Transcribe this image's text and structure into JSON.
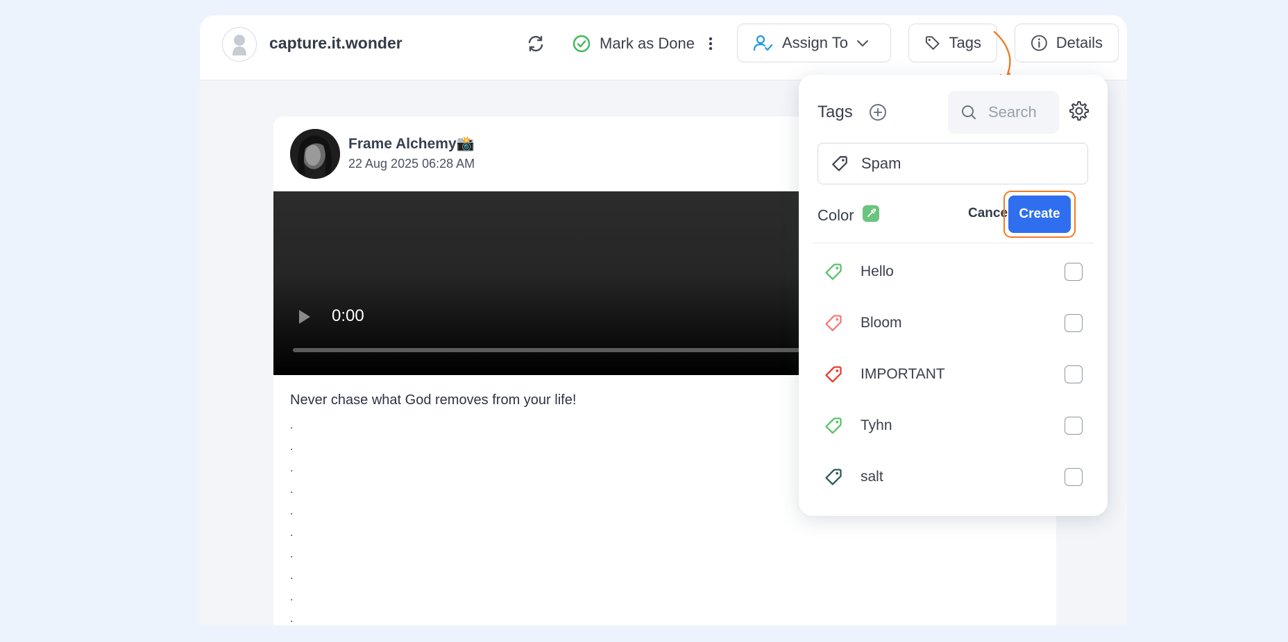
{
  "header": {
    "account_name": "capture.it.wonder",
    "mark_done_label": "Mark as Done",
    "assign_label": "Assign To",
    "tags_label": "Tags",
    "details_label": "Details"
  },
  "post": {
    "author": "Frame Alchemy📸",
    "date": "22 Aug 2025 06:28 AM",
    "video_time": "0:00",
    "caption": "Never chase what God removes from your life!",
    "dots": [
      ".",
      ".",
      ".",
      ".",
      ".",
      ".",
      ".",
      ".",
      ".",
      "."
    ]
  },
  "tags_panel": {
    "title": "Tags",
    "search_placeholder": "Search",
    "new_tag_value": "Spam",
    "color_label": "Color",
    "selected_color": "#6cc57e",
    "cancel_label": "Cancel",
    "create_label": "Create",
    "tags": [
      {
        "name": "Hello",
        "color": "#5cc26c"
      },
      {
        "name": "Bloom",
        "color": "#f47b7b"
      },
      {
        "name": "IMPORTANT",
        "color": "#ef3b2d"
      },
      {
        "name": "Tyhn",
        "color": "#5cc26c"
      },
      {
        "name": "salt",
        "color": "#2f5e5c"
      }
    ]
  },
  "colors": {
    "accent": "#2f6fef",
    "highlight": "#f07b23",
    "mark_done_green": "#3cb95a",
    "assign_blue": "#1e9ae0"
  }
}
